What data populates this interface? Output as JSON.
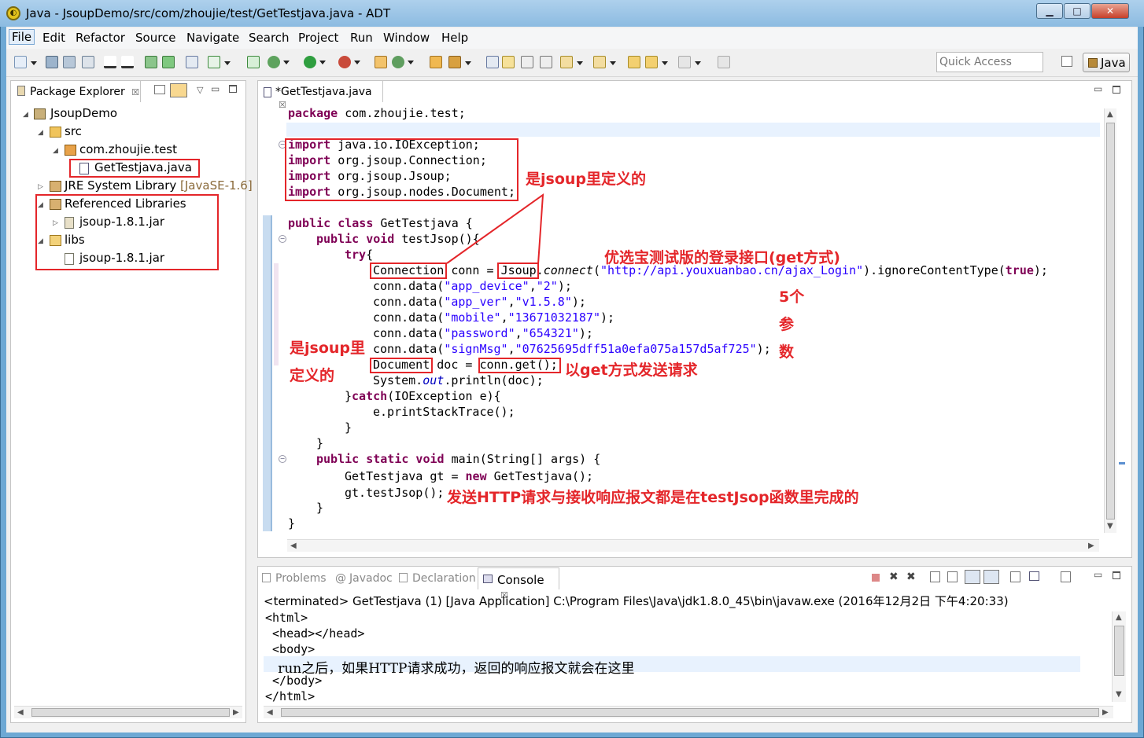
{
  "window": {
    "title": "Java - JsoupDemo/src/com/zhoujie/test/GetTestjava.java - ADT",
    "min_label": "▁",
    "max_label": "□",
    "close_label": "✕"
  },
  "menu": [
    "File",
    "Edit",
    "Refactor",
    "Source",
    "Navigate",
    "Search",
    "Project",
    "Run",
    "Window",
    "Help"
  ],
  "toolbar": {
    "quick_access_placeholder": "Quick Access",
    "perspective_label": "Java"
  },
  "package_explorer": {
    "tab_label": "Package Explorer",
    "tab_close": "☒",
    "project": "JsoupDemo",
    "src": "src",
    "package": "com.zhoujie.test",
    "file": "GetTestjava.java",
    "jre": "JRE System Library",
    "jre_version": "[JavaSE-1.6]",
    "ref_libs": "Referenced Libraries",
    "jar1": "jsoup-1.8.1.jar",
    "libs": "libs",
    "jar2": "jsoup-1.8.1.jar"
  },
  "editor": {
    "tab_label": "*GetTestjava.java",
    "tab_close": "☒",
    "code": {
      "l1_kw": "package",
      "l1_rest": " com.zhoujie.test;",
      "imp_kw": "import",
      "imp1": " java.io.IOException;",
      "imp2": " org.jsoup.Connection;",
      "imp3": " org.jsoup.Jsoup;",
      "imp4": " org.jsoup.nodes.Document;",
      "class_kw": "public class",
      "class_name": " GetTestjava {",
      "method_kw": "public void",
      "method_name": " testJsop(){",
      "try_kw": "try",
      "try_brace": "{",
      "conn_type": "Connection",
      "conn_var": " conn = ",
      "jsoup": "Jsoup",
      "dot": ".",
      "connect": "connect",
      "paren_open": "(",
      "url": "\"http://api.youxuanbao.cn/ajax_Login\"",
      "ignore": ").ignoreContentType(",
      "true_kw": "true",
      "end": ");",
      "data_prefix": "conn.data(",
      "d1_k": "\"app_device\"",
      "d1_v": "\"2\"",
      "d2_k": "\"app_ver\"",
      "d2_v": "\"v1.5.8\"",
      "d3_k": "\"mobile\"",
      "d3_v": "\"13671032187\"",
      "d4_k": "\"password\"",
      "d4_v": "\"654321\"",
      "d5_k": "\"signMsg\"",
      "d5_v": "\"07625695dff51a0efa075a157d5af725\"",
      "comma": ",",
      "close": ");",
      "doc_type": "Document",
      "doc_var": " doc = ",
      "conn_get": "conn.get();",
      "sys": "System.",
      "out": "out",
      "println": ".println(doc);",
      "catch_pre": "}",
      "catch_kw": "catch",
      "catch_rest": "(IOException e){",
      "trace": "e.printStackTrace();",
      "brace": "}",
      "main_kw": "public static void",
      "main_rest": " main(String[] args) {",
      "gt_pre": "GetTestjava gt = ",
      "new_kw": "new",
      "gt_post": " GetTestjava();",
      "gt_call": "gt.testJsop();"
    }
  },
  "annotations": {
    "a1": "是jsoup里定义的",
    "a2": "优选宝测试版的登录接口(get方式)",
    "a3_1": "5个",
    "a3_2": "参",
    "a3_3": "数",
    "a4_1": "是jsoup里",
    "a4_2": "定义的",
    "a5": "以get方式发送请求",
    "a6": "发送HTTP请求与接收响应报文都是在testJsop函数里完成的"
  },
  "console": {
    "tabs": [
      "Problems",
      "Javadoc",
      "Declaration",
      "Console"
    ],
    "tab_close": "☒",
    "status": "<terminated> GetTestjava (1) [Java Application] C:\\Program Files\\Java\\jdk1.8.0_45\\bin\\javaw.exe (2016年12月2日 下午4:20:33)",
    "lines": [
      "<html>",
      " <head></head>",
      " <body>",
      "   run之后，如果HTTP请求成功，返回的响应报文就会在这里",
      " </body>",
      "</html>"
    ]
  },
  "colors": {
    "keyword": "#7f0055",
    "string": "#2a00ff",
    "annotation_red": "#e4262a",
    "titlebar": "#8cbbe1"
  }
}
